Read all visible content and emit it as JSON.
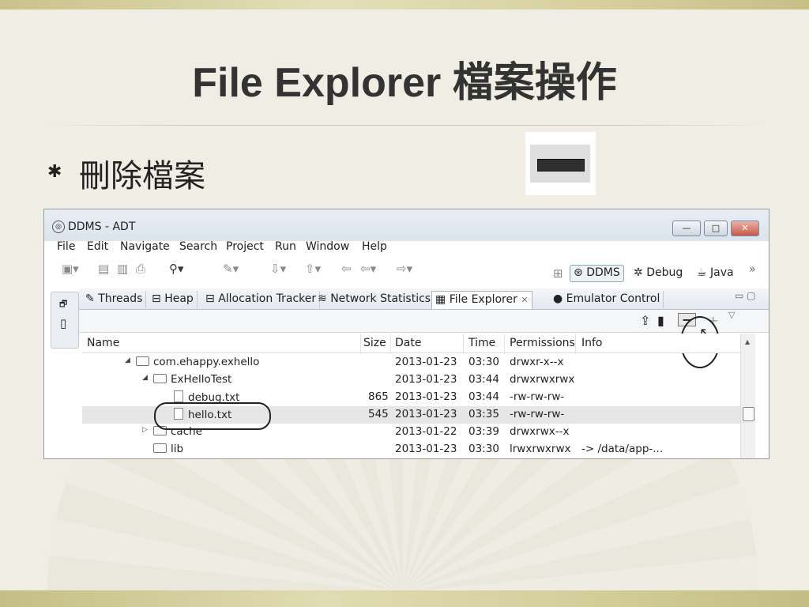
{
  "slide": {
    "title": "File Explorer 檔案操作",
    "bullet_symbol": "✱",
    "bullet_text": "刪除檔案"
  },
  "window": {
    "title": "DDMS - ADT",
    "controls": [
      "—",
      "□",
      "✕"
    ]
  },
  "menu": [
    "File",
    "Edit",
    "Navigate",
    "Search",
    "Project",
    "Run",
    "Window",
    "Help"
  ],
  "perspectives": {
    "ddms": "DDMS",
    "debug": "Debug",
    "java": "Java",
    "more": "»"
  },
  "tabs": [
    {
      "label": "Threads",
      "icon": "threads-icon"
    },
    {
      "label": "Heap",
      "icon": "heap-icon"
    },
    {
      "label": "Allocation Tracker",
      "icon": "allocation-icon"
    },
    {
      "label": "Network Statistics",
      "icon": "network-icon"
    },
    {
      "label": "File Explorer",
      "icon": "file-explorer-icon",
      "close": "✕",
      "active": true
    },
    {
      "label": "Emulator Control",
      "icon": "emulator-icon"
    }
  ],
  "view_tools": {
    "pull": "pull-file-icon",
    "push": "push-file-icon",
    "delete": "−",
    "new_folder": "+",
    "menu": "▽"
  },
  "columns": [
    "Name",
    "Size",
    "Date",
    "Time",
    "Permissions",
    "Info"
  ],
  "rows": [
    {
      "name": "com.ehappy.exhello",
      "type": "folder",
      "expanded": "open",
      "size": "",
      "date": "2013-01-23",
      "time": "03:30",
      "permissions": "drwxr-x--x",
      "info": ""
    },
    {
      "name": "ExHelloTest",
      "type": "folder",
      "expanded": "open",
      "size": "",
      "date": "2013-01-23",
      "time": "03:44",
      "permissions": "drwxrwxrwx",
      "info": ""
    },
    {
      "name": "debug.txt",
      "type": "file",
      "size": "865",
      "date": "2013-01-23",
      "time": "03:44",
      "permissions": "-rw-rw-rw-",
      "info": ""
    },
    {
      "name": "hello.txt",
      "type": "file",
      "size": "545",
      "date": "2013-01-23",
      "time": "03:35",
      "permissions": "-rw-rw-rw-",
      "info": "",
      "selected": true
    },
    {
      "name": "cache",
      "type": "folder",
      "expanded": "closed",
      "size": "",
      "date": "2013-01-22",
      "time": "03:39",
      "permissions": "drwxrwx--x",
      "info": ""
    },
    {
      "name": "lib",
      "type": "folder",
      "size": "",
      "date": "2013-01-23",
      "time": "03:30",
      "permissions": "lrwxrwxrwx",
      "info": "-> /data/app-..."
    }
  ]
}
